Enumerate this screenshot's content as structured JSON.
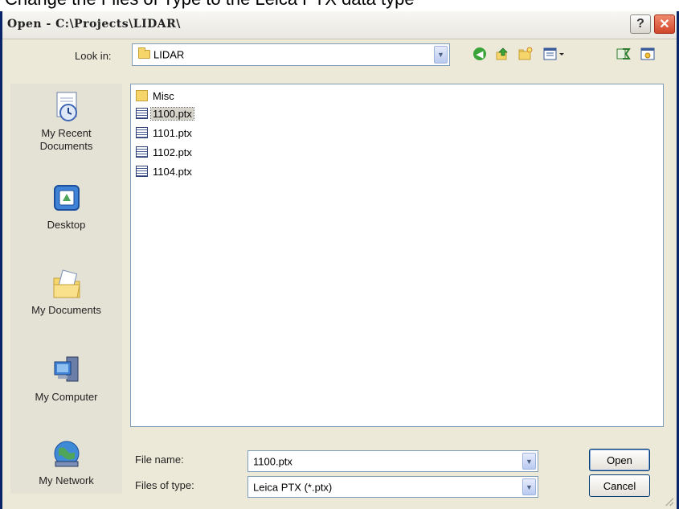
{
  "caption": "Change the Files of Type to the Leica PTX data type",
  "dialog": {
    "title": "Open - C:\\Projects\\LIDAR\\",
    "help_label": "?",
    "close_label": "✕"
  },
  "lookin": {
    "label": "Look in:",
    "value": "LIDAR"
  },
  "toolbar": {
    "icons": [
      "back-icon",
      "up-folder-icon",
      "new-folder-icon",
      "views-menu-icon",
      "tools-icon",
      "desktop-icon"
    ]
  },
  "places": [
    {
      "label": "My Recent\nDocuments",
      "icon": "recent-documents-icon"
    },
    {
      "label": "Desktop",
      "icon": "desktop-icon"
    },
    {
      "label": "My Documents",
      "icon": "my-documents-icon"
    },
    {
      "label": "My Computer",
      "icon": "my-computer-icon"
    },
    {
      "label": "My Network",
      "icon": "my-network-icon"
    }
  ],
  "files": [
    {
      "name": "Misc",
      "type": "folder"
    },
    {
      "name": "1100.ptx",
      "type": "file",
      "selected": true
    },
    {
      "name": "1101.ptx",
      "type": "file"
    },
    {
      "name": "1102.ptx",
      "type": "file"
    },
    {
      "name": "1104.ptx",
      "type": "file"
    }
  ],
  "filename": {
    "label": "File name:",
    "value": "1100.ptx"
  },
  "filetype": {
    "label": "Files of type:",
    "value": "Leica PTX (*.ptx)"
  },
  "buttons": {
    "open": "Open",
    "cancel": "Cancel"
  },
  "colors": {
    "title_frame": "#0a246a",
    "dialog_bg": "#ece9d8",
    "close_button": "#d1462a"
  }
}
